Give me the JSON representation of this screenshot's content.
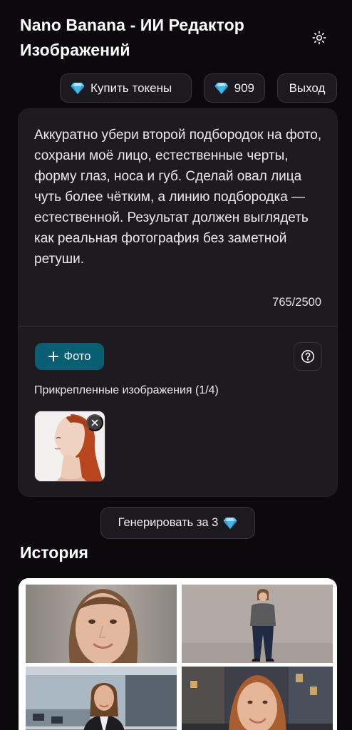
{
  "app": {
    "title": "Nano Banana - ИИ Редактор Изображений"
  },
  "header": {
    "theme_icon": "sun-icon"
  },
  "toolbar": {
    "buy_label": "Купить токены",
    "balance": "909",
    "logout_label": "Выход",
    "gem_icon": "gem-icon"
  },
  "editor": {
    "prompt": "Аккуратно убери второй подбородок на фото, сохрани моё лицо, естественные черты, форму глаз, носа и губ. Сделай овал лица чуть более чётким, а линию подбородка — естественной. Результат должен выглядеть как реальная фотография без заметной ретуши.",
    "char_count": "765/2500",
    "photo_button": "Фото",
    "attached_label": "Прикрепленные изображения (1/4)",
    "attachments_count": 1,
    "attachments_max": 4
  },
  "generate": {
    "label": "Генерировать за 3"
  },
  "history": {
    "title": "История"
  },
  "colors": {
    "background": "#0b090c",
    "card": "#1d1a20",
    "accent": "#0a5e74",
    "gem": "#5ec8f2"
  }
}
